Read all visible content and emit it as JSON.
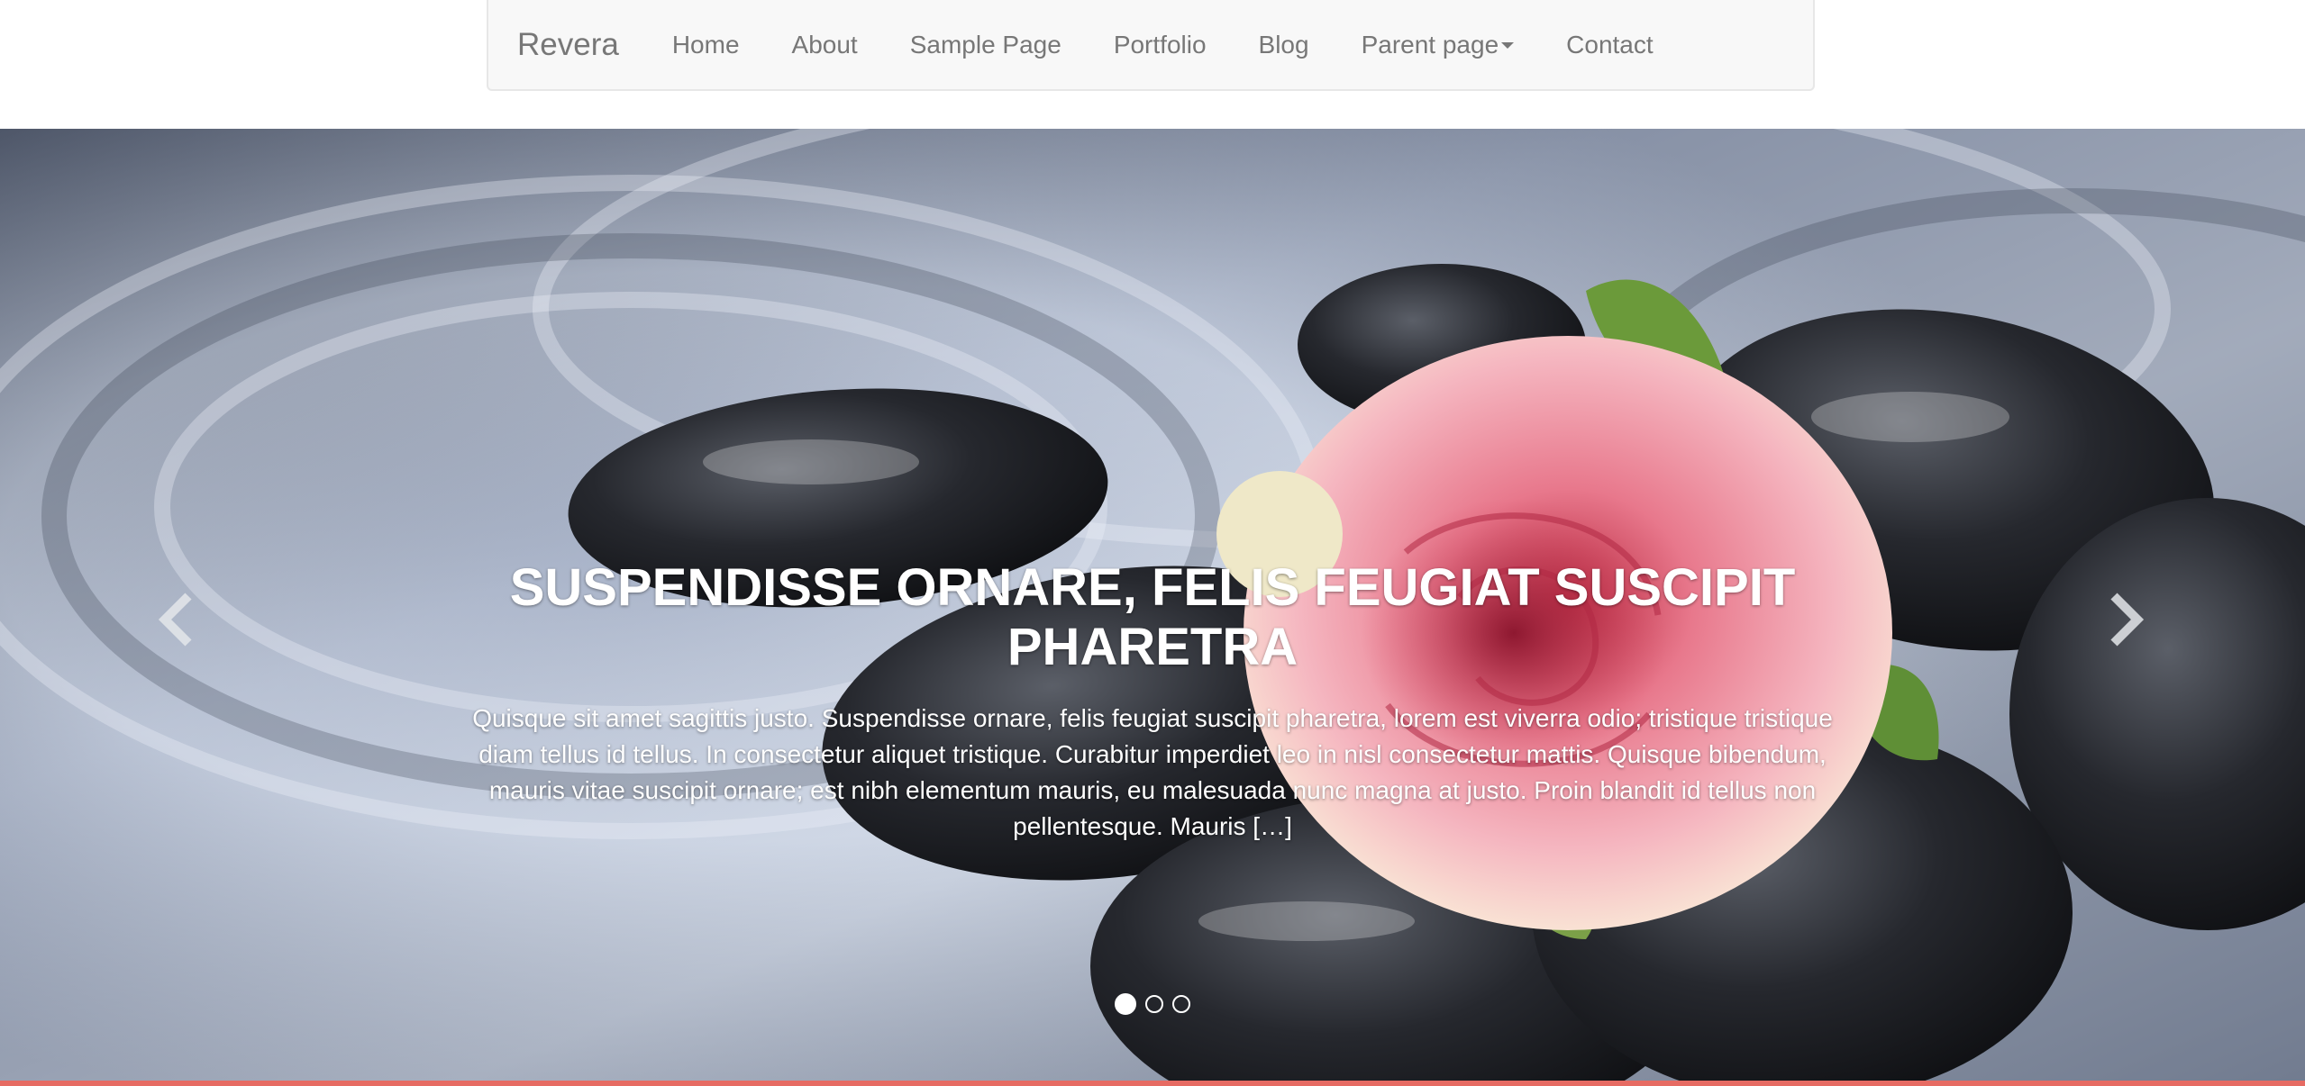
{
  "navbar": {
    "brand": "Revera",
    "items": [
      {
        "label": "Home"
      },
      {
        "label": "About"
      },
      {
        "label": "Sample Page"
      },
      {
        "label": "Portfolio"
      },
      {
        "label": "Blog"
      },
      {
        "label": "Parent page",
        "has_dropdown": true
      },
      {
        "label": "Contact"
      }
    ]
  },
  "carousel": {
    "slide": {
      "title": "SUSPENDISSE ORNARE, FELIS FEUGIAT SUSCIPIT PHARETRA",
      "excerpt": "Quisque sit amet sagittis justo. Suspendisse ornare, felis feugiat suscipit pharetra, lorem est viverra odio; tristique tristique diam tellus id tellus. In consectetur aliquet tristique. Curabitur imperdiet leo in nisl consectetur mattis. Quisque bibendum, mauris vitae suscipit ornare; est nibh elementum mauris, eu malesuada nunc magna at justo. Proin blandit id tellus non pellentesque. Mauris […]"
    },
    "indicators": [
      {
        "active": true
      },
      {
        "active": false
      },
      {
        "active": false
      }
    ],
    "prev_icon": "chevron-left-icon",
    "next_icon": "chevron-right-icon"
  },
  "colors": {
    "navbar_bg": "#f8f8f8",
    "nav_text": "#777777",
    "accent_line": "#e66b63",
    "caption_text": "#ffffff"
  }
}
